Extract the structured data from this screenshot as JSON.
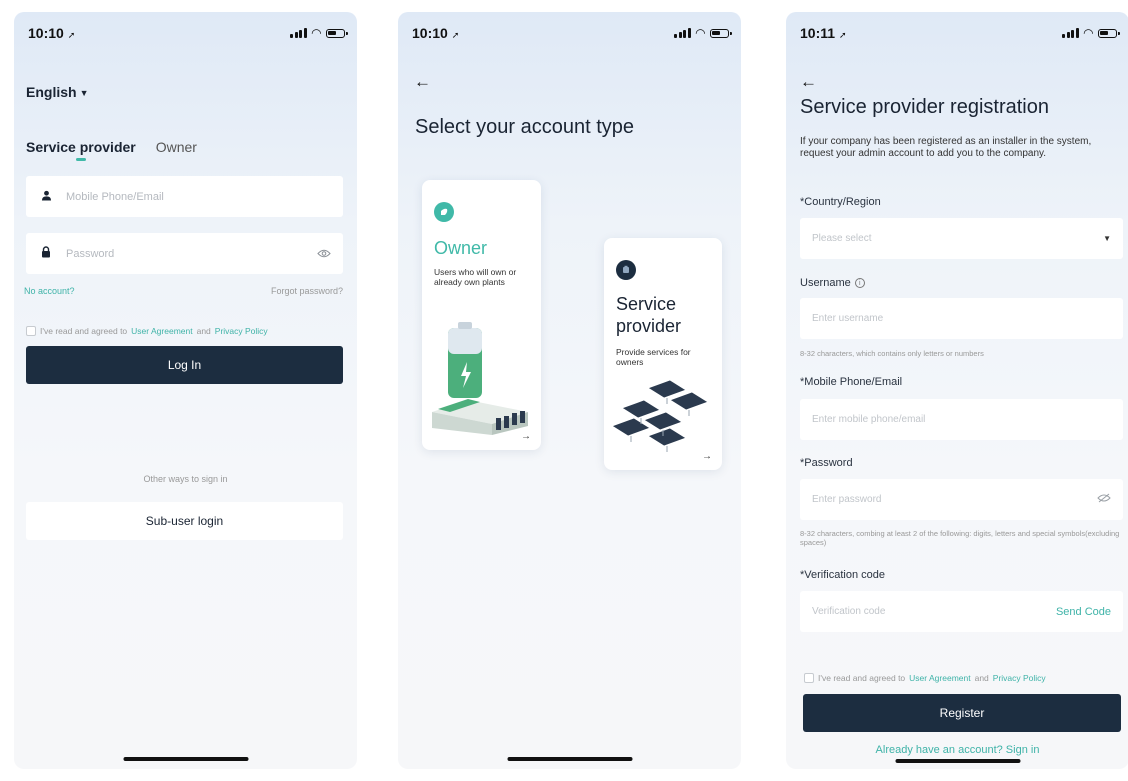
{
  "screen1": {
    "time": "10:10",
    "language": "English",
    "tabs": [
      "Service provider",
      "Owner"
    ],
    "login_placeholder": "Mobile Phone/Email",
    "password_placeholder": "Password",
    "no_account": "No account?",
    "forgot_password": "Forgot password?",
    "agree_prefix": "I've read and agreed to",
    "user_agreement": "User Agreement",
    "and": "and",
    "privacy_policy": "Privacy Policy",
    "login_button": "Log In",
    "other_ways": "Other ways to sign in",
    "sub_user_login": "Sub-user login"
  },
  "screen2": {
    "time": "10:10",
    "title": "Select your account type",
    "owner_card": {
      "title": "Owner",
      "description": "Users who will own or already own plants"
    },
    "provider_card": {
      "title": "Service provider",
      "description": "Provide services for owners"
    },
    "arrow": "→",
    "colors": {
      "accent": "#40b9a8",
      "dark": "#1c2d40"
    }
  },
  "screen3": {
    "time": "10:11",
    "title": "Service provider registration",
    "intro": "If your company has been registered as an installer in the system, request your admin account to add you to the company.",
    "country_label": "*Country/Region",
    "country_placeholder": "Please select",
    "username_label": "Username",
    "username_placeholder": "Enter username",
    "username_hint": "8-32 characters, which contains only letters or numbers",
    "phone_label": "*Mobile Phone/Email",
    "phone_placeholder": "Enter mobile phone/email",
    "password_label": "*Password",
    "password_placeholder": "Enter password",
    "password_hint": "8-32 characters, combing at least 2 of the following: digits, letters and special symbols(excluding spaces)",
    "verification_label": "*Verification code",
    "verification_placeholder": "Verification code",
    "send_code": "Send Code",
    "agree_prefix": "I've read and agreed to",
    "user_agreement": "User Agreement",
    "and": "and",
    "privacy_policy": "Privacy Policy",
    "register_button": "Register",
    "signin_link": "Already have an account? Sign in"
  }
}
